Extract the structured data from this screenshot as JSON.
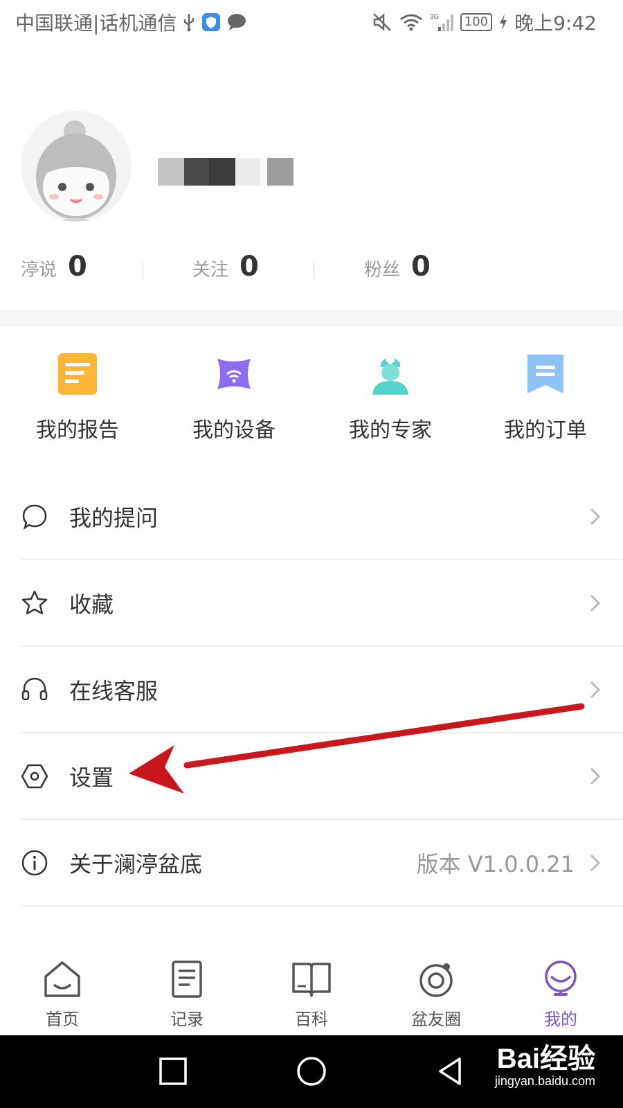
{
  "status_bar": {
    "carrier": "中国联通|话机通信",
    "time": "晚上9:42",
    "battery": "100",
    "network": "3G"
  },
  "profile": {
    "stats": [
      {
        "label": "渟说",
        "value": "0"
      },
      {
        "label": "关注",
        "value": "0"
      },
      {
        "label": "粉丝",
        "value": "0"
      }
    ]
  },
  "quick_actions": [
    {
      "label": "我的报告",
      "icon": "report-icon",
      "color": "#ffb637"
    },
    {
      "label": "我的设备",
      "icon": "device-icon",
      "color": "#8c6cf0"
    },
    {
      "label": "我的专家",
      "icon": "expert-icon",
      "color": "#56d3cc"
    },
    {
      "label": "我的订单",
      "icon": "order-icon",
      "color": "#8fc2f5"
    }
  ],
  "menu": [
    {
      "label": "我的提问",
      "icon": "chat-bubble-icon",
      "extra": ""
    },
    {
      "label": "收藏",
      "icon": "star-icon",
      "extra": ""
    },
    {
      "label": "在线客服",
      "icon": "headset-icon",
      "extra": ""
    },
    {
      "label": "设置",
      "icon": "hex-settings-icon",
      "extra": ""
    },
    {
      "label": "关于澜渟盆底",
      "icon": "info-icon",
      "extra": "版本 V1.0.0.21"
    }
  ],
  "bottom_nav": [
    {
      "label": "首页",
      "icon": "home-icon"
    },
    {
      "label": "记录",
      "icon": "record-icon"
    },
    {
      "label": "百科",
      "icon": "book-icon"
    },
    {
      "label": "盆友圈",
      "icon": "circle-icon"
    },
    {
      "label": "我的",
      "icon": "profile-icon",
      "active": true
    }
  ],
  "theme": {
    "accent": "#7a55c8",
    "annotation_arrow": "#c8181e"
  },
  "watermark": {
    "main": "Bai经验",
    "sub": "jingyan.baidu.com"
  }
}
